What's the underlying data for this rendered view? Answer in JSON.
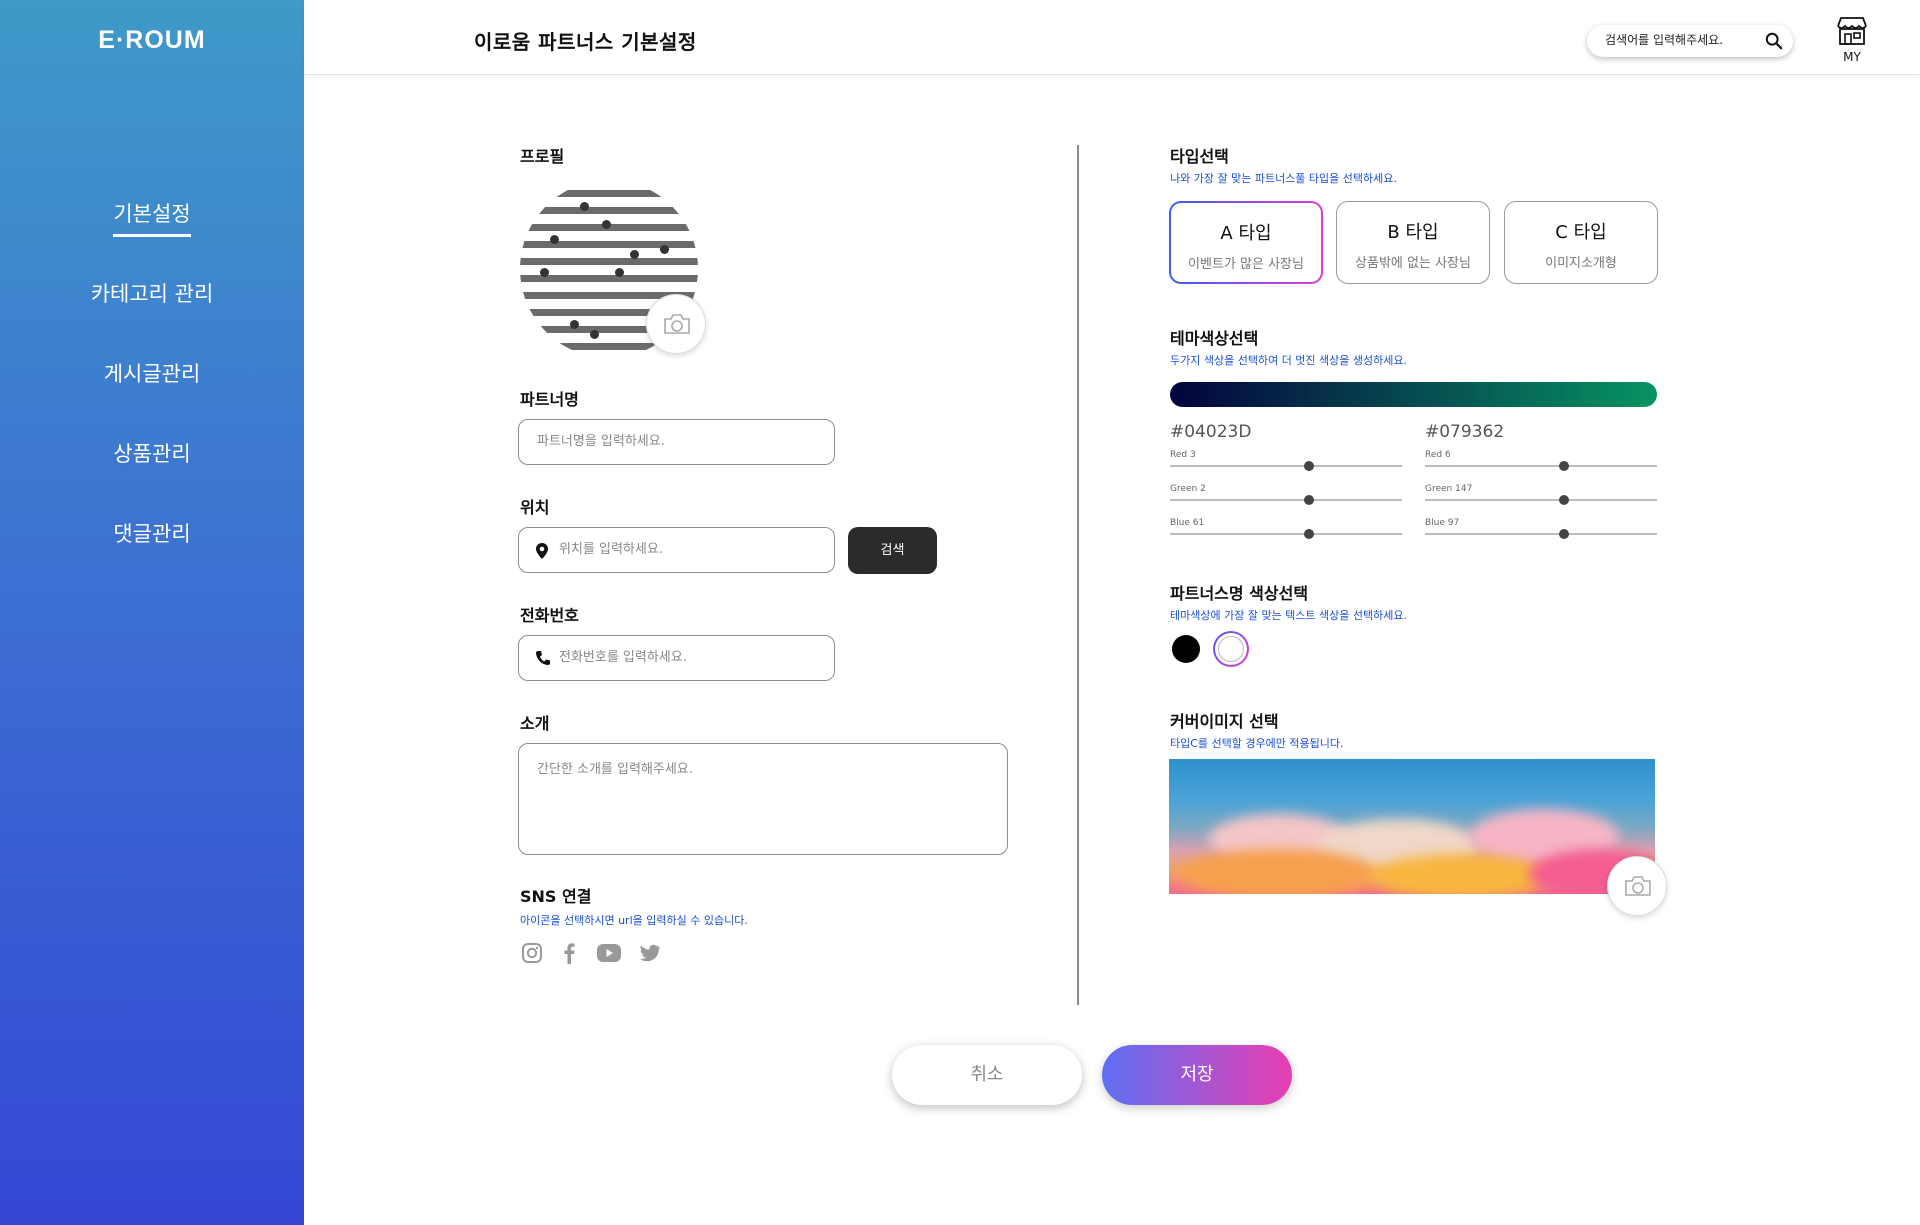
{
  "sidebar": {
    "logo": "E·ROUM",
    "items": [
      {
        "label": "기본설정",
        "active": true
      },
      {
        "label": "카테고리 관리"
      },
      {
        "label": "게시글관리"
      },
      {
        "label": "상품관리"
      },
      {
        "label": "댓글관리"
      }
    ]
  },
  "header": {
    "title": "이로움 파트너스 기본설정",
    "search_placeholder": "검색어를 입력해주세요.",
    "my_label": "MY"
  },
  "profile": {
    "label": "프로필",
    "icons": {
      "camera": "camera-icon"
    }
  },
  "partner_name": {
    "label": "파트너명",
    "placeholder": "파트너명을 입력하세요."
  },
  "location": {
    "label": "위치",
    "placeholder": "위치를 입력하세요.",
    "search_button": "검색",
    "icon": "location-pin-icon"
  },
  "phone": {
    "label": "전화번호",
    "placeholder": "전화번호를 입력하세요.",
    "icon": "phone-icon"
  },
  "intro": {
    "label": "소개",
    "placeholder": "간단한 소개를 입력해주세요."
  },
  "sns": {
    "label": "SNS 연결",
    "hint": "아이콘을 선택하시면 url을 입력하실 수 있습니다.",
    "icons": [
      "instagram-icon",
      "facebook-icon",
      "youtube-icon",
      "twitter-icon"
    ]
  },
  "type_select": {
    "label": "타입선택",
    "hint": "나와 가장 잘 맞는 파트너스풀 타입을 선택하세요.",
    "cards": [
      {
        "title": "A 타입",
        "subtitle": "이벤트가 많은 사장님",
        "selected": true
      },
      {
        "title": "B 타입",
        "subtitle": "상품밖에 없는 사장님"
      },
      {
        "title": "C 타입",
        "subtitle": "이미지소개형"
      }
    ]
  },
  "theme_color": {
    "label": "테마색상선택",
    "hint": "두가지 색상을 선택하여 더 멋진 색상을 생성하세요.",
    "colors": [
      {
        "hex": "#04023D",
        "sliders": [
          {
            "label": "Red 3",
            "value": 3
          },
          {
            "label": "Green 2",
            "value": 2
          },
          {
            "label": "Blue 61",
            "value": 61
          }
        ]
      },
      {
        "hex": "#079362",
        "sliders": [
          {
            "label": "Red 6",
            "value": 6
          },
          {
            "label": "Green 147",
            "value": 147
          },
          {
            "label": "Blue 97",
            "value": 97
          }
        ]
      }
    ]
  },
  "partner_name_color": {
    "label": "파트너스명 색상선택",
    "hint": "테마색상에 가장 잘 맞는 텍스트 색상을 선택하세요.",
    "options": [
      "#000000",
      "#ffffff"
    ],
    "selected": "#ffffff"
  },
  "cover_image": {
    "label": "커버이미지 선택",
    "hint": "타입C를 선택할 경우에만 적용됩니다."
  },
  "actions": {
    "cancel": "취소",
    "save": "저장"
  },
  "colors": {
    "accent": "#1a4fd6",
    "dark_button": "#2b2b2b"
  }
}
